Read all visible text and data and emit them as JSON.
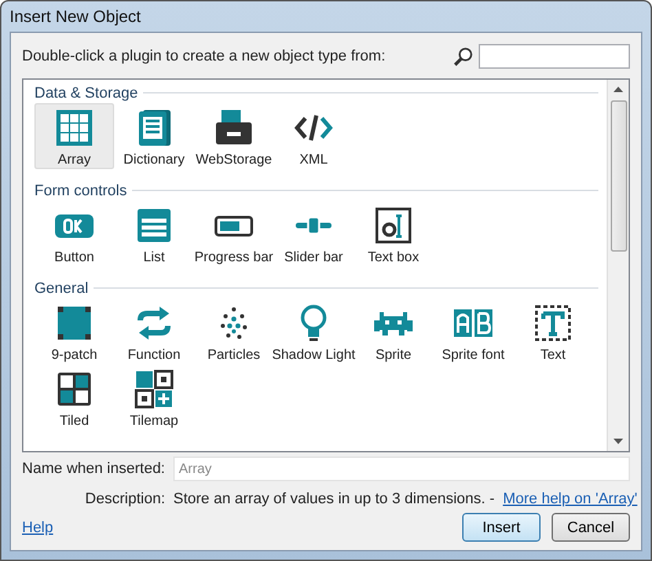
{
  "window": {
    "title": "Insert New Object"
  },
  "prompt": "Double-click a plugin to create a new object type from:",
  "sections": [
    {
      "title": "Data & Storage",
      "items": [
        {
          "label": "Array",
          "selected": true
        },
        {
          "label": "Dictionary",
          "selected": false
        },
        {
          "label": "WebStorage",
          "selected": false
        },
        {
          "label": "XML",
          "selected": false
        }
      ]
    },
    {
      "title": "Form controls",
      "items": [
        {
          "label": "Button",
          "selected": false
        },
        {
          "label": "List",
          "selected": false
        },
        {
          "label": "Progress bar",
          "selected": false
        },
        {
          "label": "Slider bar",
          "selected": false
        },
        {
          "label": "Text box",
          "selected": false
        }
      ]
    },
    {
      "title": "General",
      "items": [
        {
          "label": "9-patch",
          "selected": false
        },
        {
          "label": "Function",
          "selected": false
        },
        {
          "label": "Particles",
          "selected": false
        },
        {
          "label": "Shadow Light",
          "selected": false
        },
        {
          "label": "Sprite",
          "selected": false
        },
        {
          "label": "Sprite font",
          "selected": false
        },
        {
          "label": "Text",
          "selected": false
        },
        {
          "label": "Tiled",
          "selected": false
        },
        {
          "label": "Tilemap",
          "selected": false
        }
      ]
    }
  ],
  "name_field": {
    "label": "Name when inserted:",
    "placeholder": "Array"
  },
  "description": {
    "label": "Description:",
    "text": "Store an array of values in up to 3 dimensions. -",
    "link": "More help on 'Array'"
  },
  "help_link": "Help",
  "buttons": [
    {
      "label": "Insert",
      "kind": "default"
    },
    {
      "label": "Cancel",
      "kind": "normal"
    }
  ]
}
